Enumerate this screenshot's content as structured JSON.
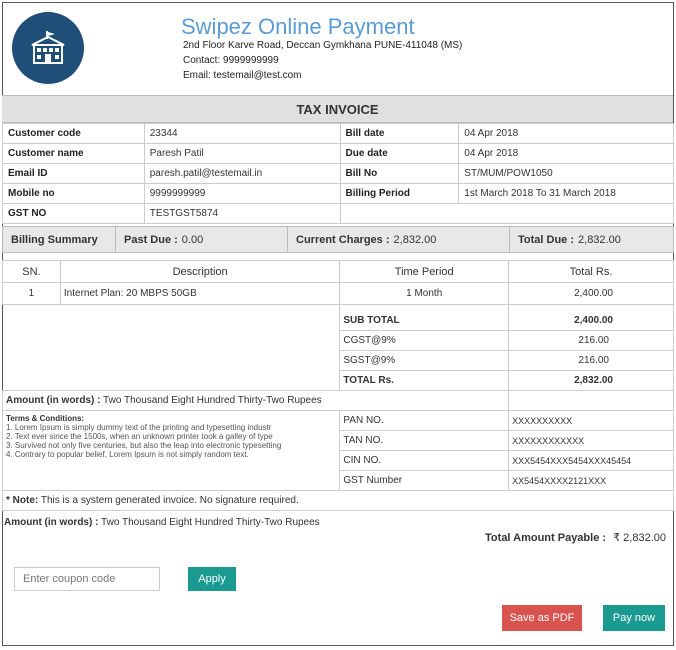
{
  "company": {
    "name": "Swipez Online Payment",
    "address": "2nd Floor Karve Road, Deccan Gymkhana PUNE-411048 (MS)",
    "contact": "Contact: 9999999999",
    "email": "Email: testemail@test.com",
    "logo_icon": "school-building-icon"
  },
  "title": "TAX INVOICE",
  "info": {
    "customer_code_label": "Customer code",
    "customer_code": "23344",
    "customer_name_label": "Customer name",
    "customer_name": "Paresh Patil",
    "email_label": "Email ID",
    "email": "paresh.patil@testemail.in",
    "mobile_label": "Mobile no",
    "mobile": "9999999999",
    "gst_label": "GST NO",
    "gst": "TESTGST5874",
    "bill_date_label": "Bill date",
    "bill_date": "04 Apr 2018",
    "due_date_label": "Due date",
    "due_date": "04 Apr 2018",
    "bill_no_label": "Bill No",
    "bill_no": "ST/MUM/POW1050",
    "billing_period_label": "Billing Period",
    "billing_period": "1st March 2018 To 31 March 2018"
  },
  "summary": {
    "label": "Billing Summary",
    "past_due_label": "Past Due :",
    "past_due": "0.00",
    "current_label": "Current Charges :",
    "current": "2,832.00",
    "total_label": "Total Due :",
    "total": "2,832.00"
  },
  "items": {
    "headers": [
      "SN.",
      "Description",
      "Time Period",
      "Total Rs."
    ],
    "rows": [
      {
        "sn": "1",
        "description": "Internet Plan: 20 MBPS 50GB",
        "period": "1 Month",
        "total": "2,400.00"
      }
    ]
  },
  "totals": {
    "subtotal_label": "SUB TOTAL",
    "subtotal": "2,400.00",
    "cgst_label": "CGST@9%",
    "cgst": "216.00",
    "sgst_label": "SGST@9%",
    "sgst": "216.00",
    "total_label": "TOTAL Rs.",
    "total": "2,832.00"
  },
  "words": {
    "label": "Amount (in words) :",
    "value": "Two Thousand Eight Hundred Thirty-Two Rupees"
  },
  "terms": {
    "title": "Terms & Conditions:",
    "lines": [
      "1.  Lorem Ipsum is simply dummy text of the printing and typesetting industr",
      "2.  Text ever since the 1500s, when an unknown printer took a galley of type",
      "3.  Survived not only five centuries, but also the leap into electronic typesetting",
      "4.  Contrary to popular belief, Lorem Ipsum is not simply random text."
    ]
  },
  "tax_ids": {
    "pan_label": "PAN NO.",
    "pan": "XXXXXXXXXX",
    "tan_label": "TAN NO.",
    "tan": "XXXXXXXXXXXX",
    "cin_label": "CIN NO.",
    "cin": "XXX5454XXX5454XXX45454",
    "gst_label": "GST Number",
    "gst": "XX5454XXXX2121XXX"
  },
  "note": {
    "label": "* Note:",
    "text": "This is a system generated invoice. No signature required."
  },
  "words2": {
    "label": "Amount (in words) :",
    "value": "Two Thousand Eight Hundred Thirty-Two Rupees"
  },
  "payable": {
    "label": "Total Amount Payable :",
    "currency": "₹",
    "amount": "2,832.00"
  },
  "coupon": {
    "placeholder": "Enter coupon code",
    "apply_label": "Apply"
  },
  "actions": {
    "save_pdf": "Save as PDF",
    "pay_now": "Pay now"
  },
  "colors": {
    "teal": "#1a9a91",
    "red": "#d9534f",
    "brand_blue": "#5b9bd5",
    "logo_bg": "#1f4e79"
  }
}
